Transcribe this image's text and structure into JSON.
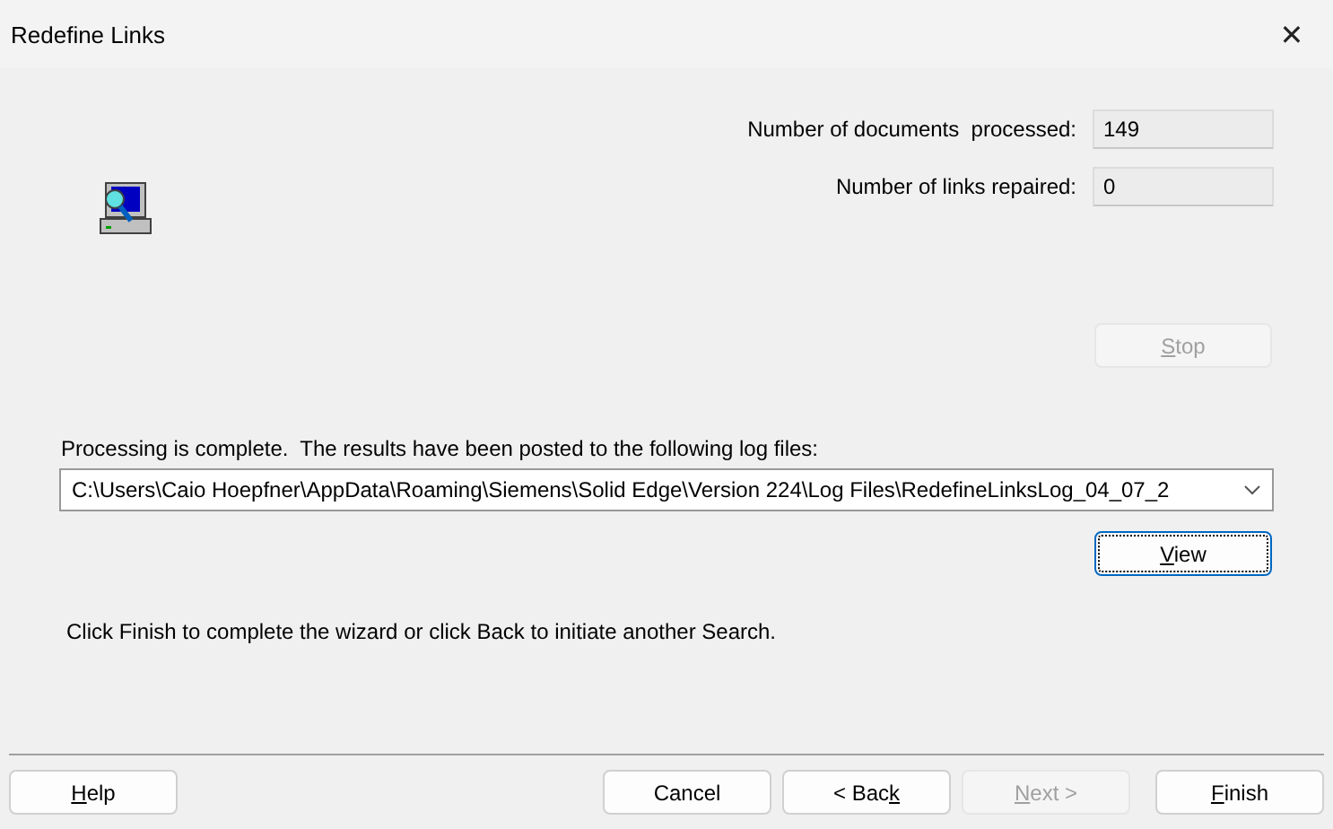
{
  "window": {
    "title": "Redefine Links",
    "close": "✕"
  },
  "stats": [
    {
      "label": "Number of documents  processed:",
      "value": "149"
    },
    {
      "label": "Number of links repaired:",
      "value": "0"
    }
  ],
  "stop_button": {
    "label": [
      {
        "text": "S",
        "underline": true
      },
      {
        "text": "top",
        "underline": false
      }
    ],
    "disabled": true
  },
  "message": "Processing is complete.  The results have been posted to the following log files:",
  "log_file": {
    "value": "C:\\Users\\Caio Hoepfner\\AppData\\Roaming\\Siemens\\Solid Edge\\Version 224\\Log Files\\RedefineLinksLog_04_07_2"
  },
  "view_button": {
    "label": [
      {
        "text": "V",
        "underline": true
      },
      {
        "text": "iew",
        "underline": false
      }
    ],
    "disabled": false,
    "focused": true
  },
  "instruction": "Click Finish to complete the wizard or click Back to initiate another Search.",
  "footer_buttons": [
    {
      "label": [
        {
          "text": "H",
          "underline": true
        },
        {
          "text": "elp",
          "underline": false
        }
      ],
      "disabled": false,
      "kind": "help"
    },
    {
      "label": [
        {
          "text": "Cancel",
          "underline": false
        }
      ],
      "disabled": false,
      "kind": "nav"
    },
    {
      "label": [
        {
          "text": "< Bac",
          "underline": false
        },
        {
          "text": "k",
          "underline": true
        }
      ],
      "disabled": false,
      "kind": "nav"
    },
    {
      "label": [
        {
          "text": "N",
          "underline": true
        },
        {
          "text": "ext >",
          "underline": false
        }
      ],
      "disabled": true,
      "kind": "nav"
    },
    {
      "label": [
        {
          "text": "F",
          "underline": true
        },
        {
          "text": "inish",
          "underline": false
        }
      ],
      "disabled": false,
      "kind": "finish"
    }
  ]
}
